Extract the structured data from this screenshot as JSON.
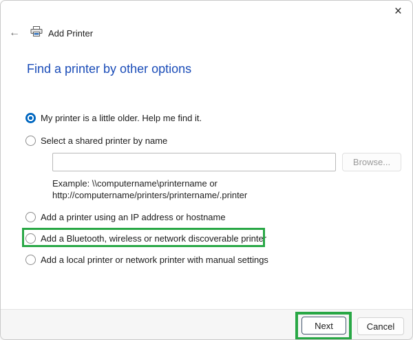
{
  "window": {
    "title": "Add Printer",
    "close_icon": "×",
    "back_icon": "←"
  },
  "heading": "Find a printer by other options",
  "options": [
    {
      "label": "My printer is a little older. Help me find it.",
      "selected": true,
      "highlighted": false
    },
    {
      "label": "Select a shared printer by name",
      "selected": false,
      "highlighted": false
    },
    {
      "label": "Add a printer using an IP address or hostname",
      "selected": false,
      "highlighted": false
    },
    {
      "label": "Add a Bluetooth, wireless or network discoverable printer",
      "selected": false,
      "highlighted": true
    },
    {
      "label": "Add a local printer or network printer with manual settings",
      "selected": false,
      "highlighted": false
    }
  ],
  "shared_printer": {
    "input_value": "",
    "browse_label": "Browse...",
    "example_line1": "Example: \\\\computername\\printername or",
    "example_line2": "http://computername/printers/printername/.printer"
  },
  "footer": {
    "next_label": "Next",
    "cancel_label": "Cancel"
  },
  "colors": {
    "accent_blue": "#0067c0",
    "heading_blue": "#1a4cb8",
    "highlight_green": "#28a745"
  }
}
